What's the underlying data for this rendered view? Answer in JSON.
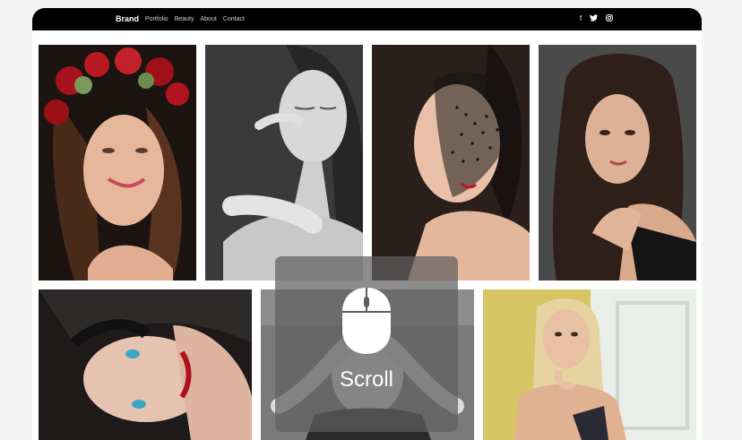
{
  "nav": {
    "brand": "Brand",
    "links": [
      "Portfolio",
      "Beauty",
      "About",
      "Contact"
    ],
    "social_icons": [
      "facebook-icon",
      "twitter-icon",
      "instagram-icon"
    ]
  },
  "gallery": {
    "row1": [
      {
        "name": "photo-flower-crown-portrait",
        "tone": "color"
      },
      {
        "name": "photo-bw-eyes-closed-portrait",
        "tone": "monochrome"
      },
      {
        "name": "photo-veil-profile-portrait",
        "tone": "color"
      },
      {
        "name": "photo-dark-hair-portrait",
        "tone": "color"
      }
    ],
    "row2": [
      {
        "name": "photo-blue-eyes-portrait",
        "tone": "color"
      },
      {
        "name": "photo-bw-hands-on-head-portrait",
        "tone": "monochrome"
      },
      {
        "name": "photo-blonde-yellow-wall-portrait",
        "tone": "color"
      }
    ]
  },
  "scroll_hint": {
    "label": "Scroll",
    "icon": "mouse-icon"
  },
  "colors": {
    "navbar": "#000000",
    "page_background": "#f4f4f4",
    "overlay": "#5f5f5f"
  }
}
